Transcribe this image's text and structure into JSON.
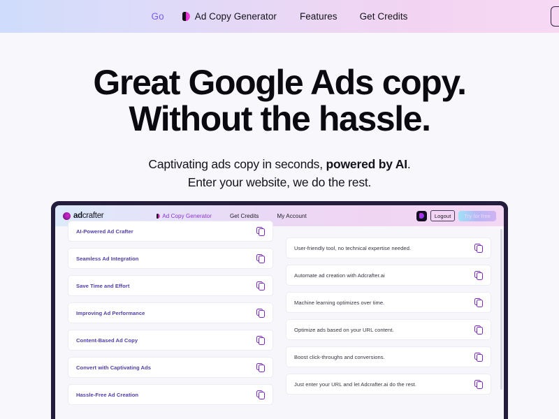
{
  "topnav": {
    "go_label": "Go",
    "brand_link": "Ad Copy Generator",
    "links": [
      "Features",
      "Get Credits"
    ]
  },
  "hero": {
    "headline_line1": "Great Google Ads copy.",
    "headline_line2": "Without the hassle.",
    "sub_line1_a": "Captivating ads copy in seconds, ",
    "sub_line1_b": "powered by AI",
    "sub_line1_c": ".",
    "sub_line2": "Enter your website, we do the rest."
  },
  "mockup": {
    "logo_bold": "ad",
    "logo_light": "crafter",
    "nav_accent_link": "Ad Copy Generator",
    "nav_links": [
      "Get Credits",
      "My Account"
    ],
    "logout_label": "Logout",
    "try_label": "Try for free",
    "left_cards": [
      "AI-Powered Ad Crafter",
      "Seamless Ad Integration",
      "Save Time and Effort",
      "Improving Ad Performance",
      "Content-Based Ad Copy",
      "Convert with Captivating Ads",
      "Hassle-Free Ad Creation"
    ],
    "right_cards": [
      "User-friendly tool, no technical expertise needed.",
      "Automate ad creation with Adcrafter.ai",
      "Machine learning optimizes over time.",
      "Optimize ads based on your URL content.",
      "Boost click-throughs and conversions.",
      "Just enter your URL and let Adcrafter.ai do the rest."
    ]
  },
  "colors": {
    "accent_purple": "#7b5cf0",
    "brand_magenta": "#d726c8",
    "card_title": "#4e3ea8",
    "frame_dark": "#241d3b",
    "page_bg": "#f8f7fc"
  }
}
